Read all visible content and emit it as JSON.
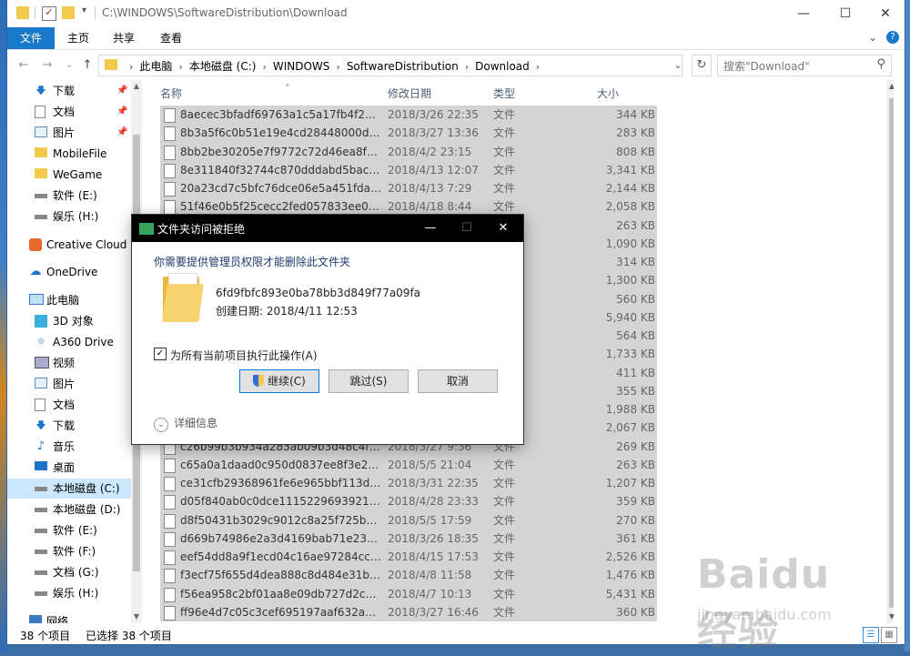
{
  "window": {
    "title_path": "C:\\WINDOWS\\SoftwareDistribution\\Download"
  },
  "ribbon": {
    "tabs": [
      "文件",
      "主页",
      "共享",
      "查看"
    ],
    "active": 0
  },
  "address": {
    "crumbs": [
      "此电脑",
      "本地磁盘 (C:)",
      "WINDOWS",
      "SoftwareDistribution",
      "Download"
    ],
    "search_placeholder": "搜索\"Download\""
  },
  "sidebar": {
    "items": [
      {
        "label": "下载",
        "icon": "download-arrow-icon",
        "pinned": true
      },
      {
        "label": "文档",
        "icon": "document-icon",
        "pinned": true
      },
      {
        "label": "图片",
        "icon": "picture-icon",
        "pinned": true
      },
      {
        "label": "MobileFile",
        "icon": "folder-icon"
      },
      {
        "label": "WeGame",
        "icon": "folder-icon"
      },
      {
        "label": "软件 (E:)",
        "icon": "drive-icon"
      },
      {
        "label": "娱乐 (H:)",
        "icon": "drive-icon"
      },
      {
        "label": "Creative Cloud F",
        "icon": "creative-cloud-icon"
      },
      {
        "label": "OneDrive",
        "icon": "onedrive-icon"
      },
      {
        "label": "此电脑",
        "icon": "computer-icon"
      },
      {
        "label": "3D 对象",
        "icon": "3d-objects-icon"
      },
      {
        "label": "A360 Drive",
        "icon": "a360-icon"
      },
      {
        "label": "视频",
        "icon": "video-icon"
      },
      {
        "label": "图片",
        "icon": "picture-icon"
      },
      {
        "label": "文档",
        "icon": "document-icon"
      },
      {
        "label": "下载",
        "icon": "download-arrow-icon"
      },
      {
        "label": "音乐",
        "icon": "music-icon"
      },
      {
        "label": "桌面",
        "icon": "desktop-icon"
      },
      {
        "label": "本地磁盘 (C:)",
        "icon": "drive-icon",
        "selected": true
      },
      {
        "label": "本地磁盘 (D:)",
        "icon": "drive-icon"
      },
      {
        "label": "软件 (E:)",
        "icon": "drive-icon"
      },
      {
        "label": "软件 (F:)",
        "icon": "drive-icon"
      },
      {
        "label": "文档 (G:)",
        "icon": "drive-icon"
      },
      {
        "label": "娱乐 (H:)",
        "icon": "drive-icon"
      },
      {
        "label": "网络",
        "icon": "network-icon"
      }
    ]
  },
  "columns": {
    "name": "名称",
    "date": "修改日期",
    "type": "类型",
    "size": "大小"
  },
  "files": [
    {
      "name": "8aecec3bfadf69763a1c5a17fb4f2048...",
      "date": "2018/3/26 22:35",
      "type": "文件",
      "size": "344 KB"
    },
    {
      "name": "8b3a5f6c0b51e19e4cd28448000d9fa...",
      "date": "2018/3/27 13:36",
      "type": "文件",
      "size": "283 KB"
    },
    {
      "name": "8bb2be30205e7f9772c72d46ea8f2ef...",
      "date": "2018/4/2 23:15",
      "type": "文件",
      "size": "808 KB"
    },
    {
      "name": "8e311840f32744c870dddabd5baca9...",
      "date": "2018/4/13 12:07",
      "type": "文件",
      "size": "3,341 KB"
    },
    {
      "name": "20a23cd7c5bfc76dce06e5a451fda1e...",
      "date": "2018/4/13 7:29",
      "type": "文件",
      "size": "2,144 KB"
    },
    {
      "name": "51f46e0b5f25cecc2fed057833ee0c4e...",
      "date": "2018/4/18 8:44",
      "type": "文件",
      "size": "2,058 KB"
    },
    {
      "name": "",
      "date": "",
      "type": "",
      "size": "263 KB"
    },
    {
      "name": "",
      "date": "",
      "type": "",
      "size": "1,090 KB"
    },
    {
      "name": "",
      "date": "",
      "type": "",
      "size": "314 KB"
    },
    {
      "name": "",
      "date": "",
      "type": "",
      "size": "1,300 KB"
    },
    {
      "name": "",
      "date": "",
      "type": "",
      "size": "560 KB"
    },
    {
      "name": "",
      "date": "",
      "type": "",
      "size": "5,940 KB"
    },
    {
      "name": "",
      "date": "",
      "type": "",
      "size": "564 KB"
    },
    {
      "name": "",
      "date": "",
      "type": "",
      "size": "1,733 KB"
    },
    {
      "name": "",
      "date": "",
      "type": "",
      "size": "411 KB"
    },
    {
      "name": "",
      "date": "",
      "type": "",
      "size": "355 KB"
    },
    {
      "name": "",
      "date": "",
      "type": "",
      "size": "1,988 KB"
    },
    {
      "name": "",
      "date": "",
      "type": "",
      "size": "2,067 KB"
    },
    {
      "name": "c26b99b3b934a283ab09b3d48c4fd8...",
      "date": "2018/3/27 9:36",
      "type": "文件",
      "size": "269 KB"
    },
    {
      "name": "c65a0a1daad0c950d0837ee8f3e234e...",
      "date": "2018/5/5 21:04",
      "type": "文件",
      "size": "263 KB"
    },
    {
      "name": "ce31cfb29368961fe6e965bbf113d03e...",
      "date": "2018/3/31 22:35",
      "type": "文件",
      "size": "1,207 KB"
    },
    {
      "name": "d05f840ab0c0dce1115229693921613...",
      "date": "2018/4/28 23:33",
      "type": "文件",
      "size": "359 KB"
    },
    {
      "name": "d8f50431b3029c9012c8a25f725bdd4...",
      "date": "2018/5/5 17:59",
      "type": "文件",
      "size": "270 KB"
    },
    {
      "name": "d669b74986e2a3d4169bab71e23ba4...",
      "date": "2018/3/26 18:35",
      "type": "文件",
      "size": "361 KB"
    },
    {
      "name": "eef54dd8a9f1ecd04c16ae97284cc4e...",
      "date": "2018/4/15 17:53",
      "type": "文件",
      "size": "2,526 KB"
    },
    {
      "name": "f3ecf75f655d4dea888c8d484e31b2fc...",
      "date": "2018/4/8 11:58",
      "type": "文件",
      "size": "1,476 KB"
    },
    {
      "name": "f56ea958c2bf01aa8e09db727d2cb0d...",
      "date": "2018/4/7 10:13",
      "type": "文件",
      "size": "5,431 KB"
    },
    {
      "name": "ff96e4d7c05c3cef695197aaf632a0bb...",
      "date": "2018/3/27 16:46",
      "type": "文件",
      "size": "360 KB"
    }
  ],
  "status": {
    "count": "38 个项目",
    "selected": "已选择 38 个项目"
  },
  "dialog": {
    "title": "文件夹访问被拒绝",
    "message": "你需要提供管理员权限才能删除此文件夹",
    "folder_name": "6fd9fbfc893e0ba78bb3d849f77a09fa",
    "created": "创建日期: 2018/4/11 12:53",
    "checkbox_label": "为所有当前项目执行此操作(A)",
    "checkbox_checked": true,
    "continue_label": "继续(C)",
    "skip_label": "跳过(S)",
    "cancel_label": "取消",
    "details_label": "详细信息"
  },
  "watermark": {
    "main": "Baidu经验",
    "sub": "jingyan.baidu.com"
  }
}
